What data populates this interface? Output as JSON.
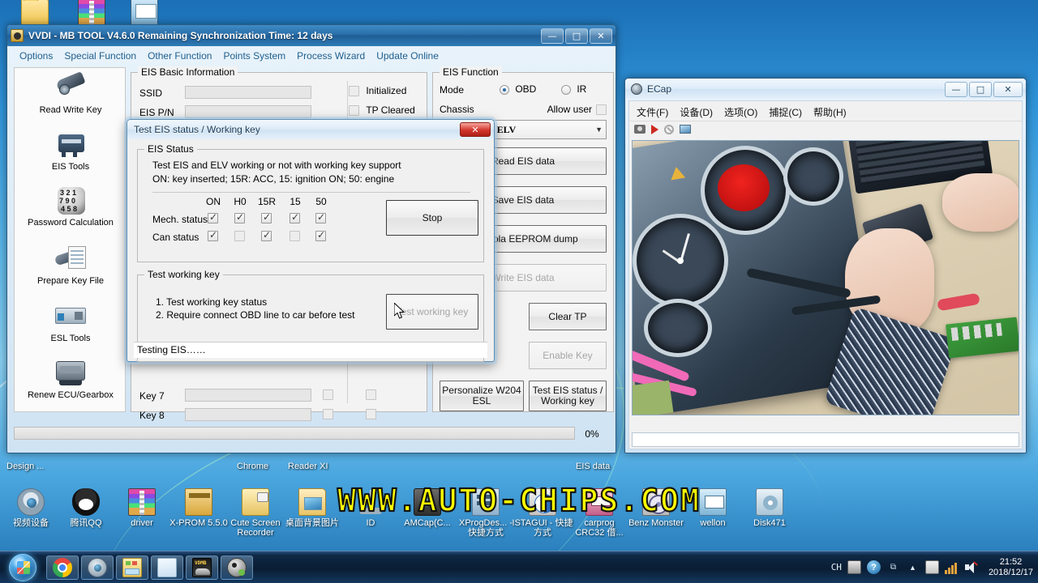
{
  "desktop": {
    "top_icons": [
      {
        "label": "",
        "icon": "folder-icon"
      },
      {
        "label": "",
        "icon": "winrar-icon"
      },
      {
        "label": "",
        "icon": "window-icon"
      }
    ],
    "icons": [
      {
        "label": "视频设备",
        "icon": "webcam-icon"
      },
      {
        "label": "腾讯QQ",
        "icon": "qq-penguin-icon"
      },
      {
        "label": "driver",
        "icon": "winrar-icon"
      },
      {
        "label": "X-PROM 5.5.0",
        "icon": "folder-icon"
      },
      {
        "label": "Cute Screen Recorder",
        "icon": "recorder-icon"
      },
      {
        "label": "桌面背景图片",
        "icon": "picture-folder-icon"
      },
      {
        "label": "ID",
        "icon": "antenna-icon"
      },
      {
        "label": "AMCap(C...",
        "icon": "amcap-icon"
      },
      {
        "label": "XProgDes... - 快捷方式",
        "icon": "xprog-icon"
      },
      {
        "label": "ISTAGUI - 快捷方式",
        "icon": "ista-icon"
      },
      {
        "label": "carprog CRC32 借...",
        "icon": "carprog-icon"
      },
      {
        "label": "Benz Monster",
        "icon": "benz-icon"
      },
      {
        "label": "wellon",
        "icon": "wellon-icon"
      },
      {
        "label": "Disk471",
        "icon": "disk-icon"
      }
    ],
    "partial_labels": [
      {
        "label": "Design ..."
      },
      {
        "label": "Chrome"
      },
      {
        "label": "Reader XI"
      },
      {
        "label": "EIS data"
      }
    ],
    "watermark": "WWW.AUTO-CHIPS.COM"
  },
  "main_window": {
    "title": "VVDI - MB TOOL V4.6.0   Remaining Synchronization Time: 12 days",
    "buttons": {
      "minimize": "—",
      "maximize": "□",
      "close": "✕"
    },
    "menu": [
      "Options",
      "Special Function",
      "Other Function",
      "Points System",
      "Process Wizard",
      "Update Online"
    ],
    "sidebar": [
      {
        "label": "Read Write Key",
        "icon": "car-key-icon"
      },
      {
        "label": "EIS Tools",
        "icon": "eis-module-icon"
      },
      {
        "label": "Password Calculation",
        "icon": "numbers-ball-icon"
      },
      {
        "label": "Prepare Key File",
        "icon": "key-file-icon"
      },
      {
        "label": "ESL Tools",
        "icon": "esl-board-icon"
      },
      {
        "label": "Renew ECU/Gearbox",
        "icon": "ecu-icon"
      }
    ],
    "basic_info": {
      "legend": "EIS Basic Information",
      "fields": [
        {
          "label": "SSID",
          "value": ""
        },
        {
          "label": "EIS P/N",
          "value": ""
        }
      ],
      "checks": [
        {
          "label": "Initialized",
          "checked": false
        },
        {
          "label": "TP Cleared",
          "checked": false
        }
      ]
    },
    "key_rows": [
      {
        "label": "Key 7",
        "value": ""
      },
      {
        "label": "Key 8",
        "value": ""
      }
    ],
    "eis_function": {
      "legend": "EIS Function",
      "mode_label": "Mode",
      "modes": [
        {
          "label": "OBD",
          "selected": true
        },
        {
          "label": "IR",
          "selected": false
        }
      ],
      "chassis_label": "Chassis",
      "allow_user_label": "Allow user",
      "allow_user_checked": false,
      "chassis_value": "07, 212(with ELV",
      "buttons": [
        {
          "label": "Read EIS data",
          "enabled": true
        },
        {
          "label": "Save EIS data",
          "enabled": true
        },
        {
          "label": "Motorola EEPROM dump",
          "enabled": true
        },
        {
          "label": "Write EIS data",
          "enabled": false
        },
        {
          "label": "Clear TP",
          "enabled": true
        },
        {
          "label": "Enable Key",
          "enabled": false
        },
        {
          "label": "Personalize W204 ESL",
          "enabled": true
        },
        {
          "label": "Test EIS status / Working key",
          "enabled": true
        }
      ]
    },
    "progress": {
      "value": 0,
      "text": "0%"
    }
  },
  "dialog": {
    "title": "Test EIS status / Working key",
    "close_label": "✕",
    "eis_status": {
      "legend": "EIS Status",
      "description_line1": "Test EIS and ELV working or not with working key support",
      "description_line2": "ON: key inserted; 15R: ACC, 15: ignition ON; 50: engine",
      "columns": [
        "ON",
        "H0",
        "15R",
        "15",
        "50"
      ],
      "rows": [
        {
          "label": "Mech. status",
          "checks": [
            true,
            true,
            true,
            true,
            true
          ]
        },
        {
          "label": "Can status",
          "checks": [
            true,
            false,
            true,
            false,
            true
          ]
        }
      ],
      "stop_button": "Stop"
    },
    "test_working_key": {
      "legend": "Test working key",
      "line1": "1. Test working key status",
      "line2": "2. Require connect OBD line to car before test",
      "button": {
        "label": "Test working key",
        "enabled": false
      }
    },
    "status_text": "Testing EIS……"
  },
  "ecap_window": {
    "title": "ECap",
    "icon": "webcam-icon",
    "buttons": {
      "minimize": "—",
      "maximize": "□",
      "close": "✕"
    },
    "menu": [
      "文件(F)",
      "设备(D)",
      "选项(O)",
      "捕捉(C)",
      "帮助(H)"
    ],
    "toolbar": [
      {
        "icon": "camera-icon"
      },
      {
        "icon": "play-icon"
      },
      {
        "icon": "stop-icon"
      },
      {
        "icon": "image-icon"
      }
    ],
    "status_text": ""
  },
  "taskbar": {
    "start_label": "",
    "items": [
      {
        "icon": "windows-orb-icon"
      },
      {
        "icon": "chrome-icon"
      },
      {
        "icon": "webcam-icon"
      },
      {
        "icon": "explorer-icon"
      },
      {
        "icon": "notepad-icon"
      },
      {
        "icon": "vvdi-mb-icon"
      },
      {
        "icon": "media-icon"
      }
    ],
    "tray": {
      "ime": "CH",
      "icons": [
        "keyboard-icon",
        "help-icon",
        "show-hidden-icon",
        "up-arrow-icon",
        "action-center-icon",
        "network-icon",
        "volume-icon"
      ],
      "time": "21:52",
      "date": "2018/12/17"
    }
  },
  "colors": {
    "desktop_blue": "#49a6df",
    "title_blue": "#2a6ea8",
    "watermark_yellow": "#ffff00",
    "close_red": "#cc2b21",
    "panel_gray": "#f3f3f3"
  }
}
